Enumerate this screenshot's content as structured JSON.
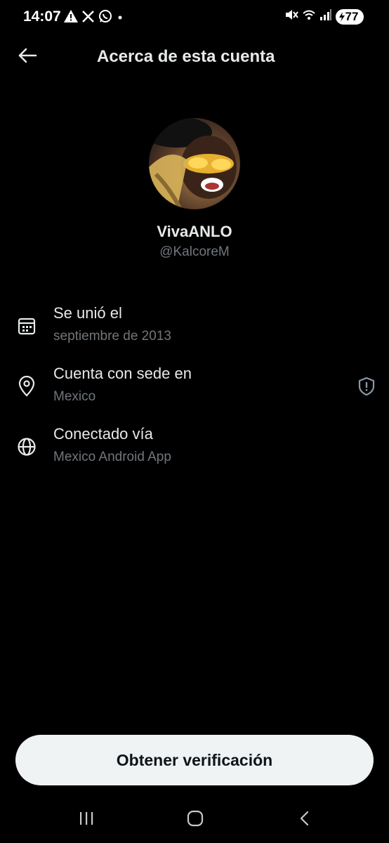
{
  "status_bar": {
    "time": "14:07",
    "battery_level": "77",
    "left_icons": [
      "warning-icon",
      "x-logo-icon",
      "whatsapp-icon",
      "dot-icon"
    ],
    "right_icons": [
      "mute-icon",
      "wifi-icon",
      "signal-icon",
      "battery-icon"
    ]
  },
  "header": {
    "title": "Acerca de esta cuenta",
    "back_icon": "arrow-left-icon"
  },
  "profile": {
    "display_name": "VivaANLO",
    "handle": "@KalcoreM"
  },
  "info": [
    {
      "icon": "calendar-icon",
      "title": "Se unió el",
      "value": "septiembre de 2013"
    },
    {
      "icon": "location-pin-icon",
      "title": "Cuenta con sede en",
      "value": "Mexico",
      "badge": "shield-icon"
    },
    {
      "icon": "globe-icon",
      "title": "Conectado vía",
      "value": "Mexico Android App"
    }
  ],
  "verify_button": {
    "label": "Obtener verificación"
  },
  "nav_bar": {
    "items": [
      "recents-icon",
      "home-icon",
      "back-icon"
    ]
  },
  "colors": {
    "background": "#000000",
    "primary_text": "#e7e9ea",
    "secondary_text": "#71767b",
    "button_bg": "#eff3f4",
    "button_text": "#0f1419"
  }
}
